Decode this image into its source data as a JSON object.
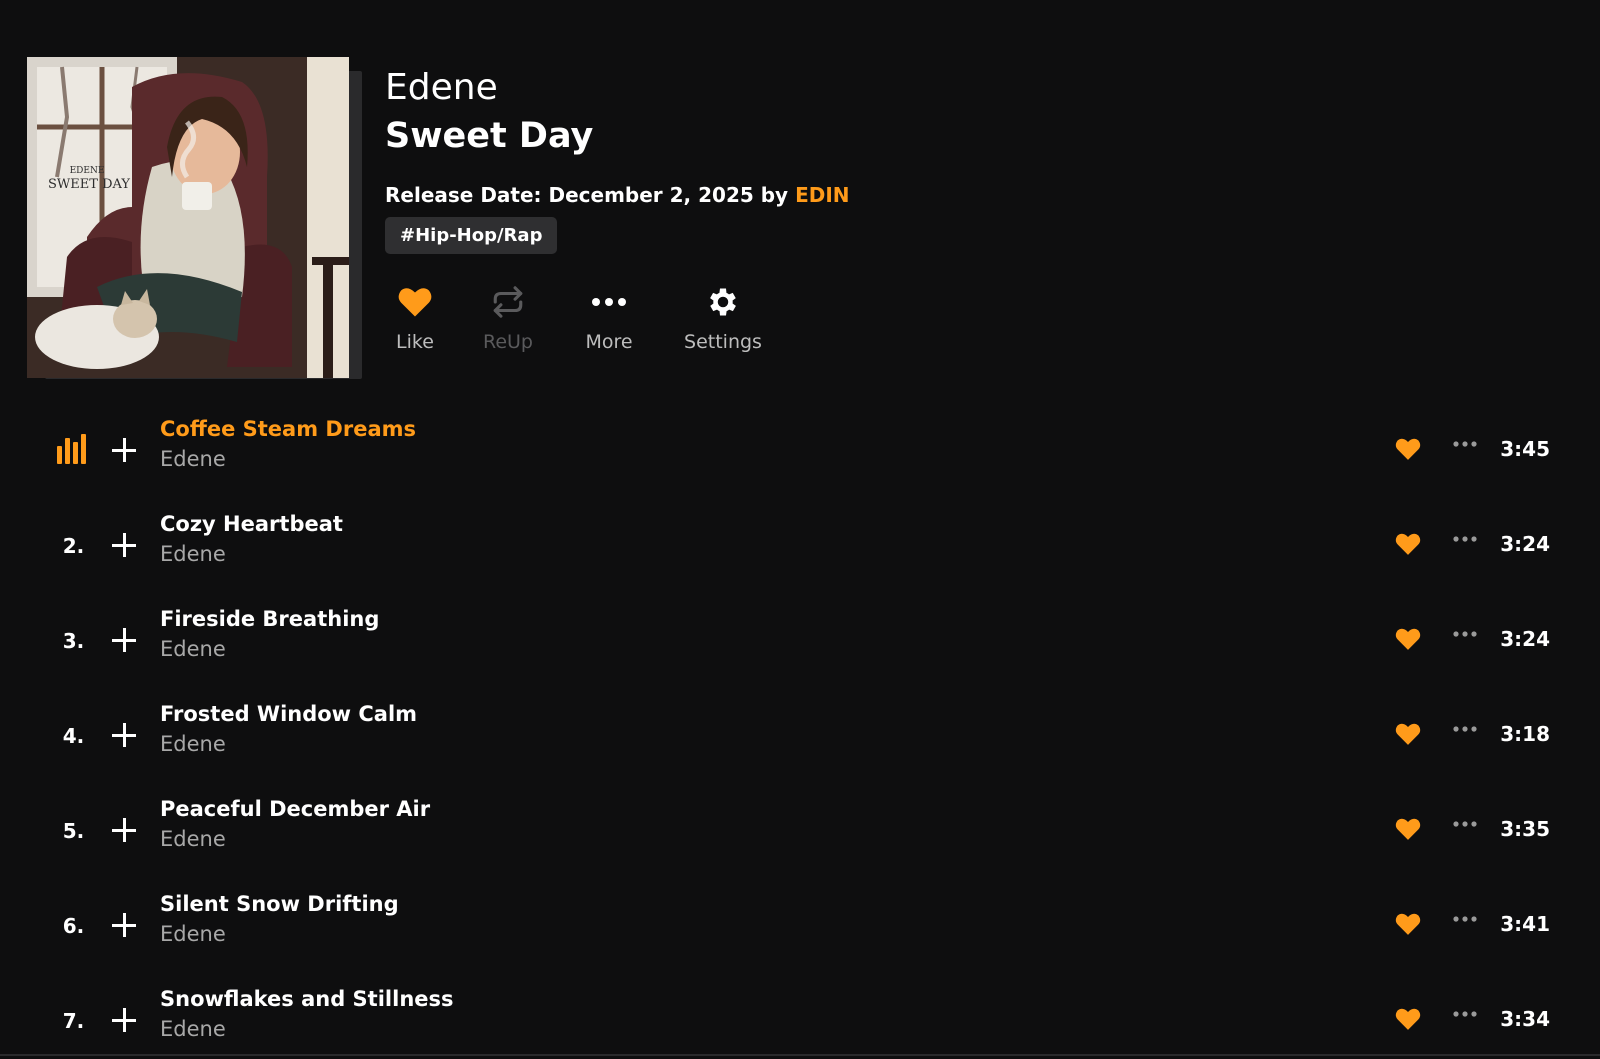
{
  "album": {
    "artist": "Edene",
    "title": "Sweet Day",
    "release_prefix": "Release Date: December 2, 2025 by ",
    "uploader": "EDIN",
    "tag": "#Hip-Hop/Rap",
    "cover_text_line1": "EDENE",
    "cover_text_line2": "SWEET DAY"
  },
  "actions": [
    {
      "label": "Like",
      "icon": "heart-icon",
      "color": "#ff9b1a"
    },
    {
      "label": "ReUp",
      "icon": "repost-icon",
      "disabled": true
    },
    {
      "label": "More",
      "icon": "more-dots-icon"
    },
    {
      "label": "Settings",
      "icon": "gear-icon"
    }
  ],
  "colors": {
    "accent": "#ff9b1a",
    "background": "#0e0e0f",
    "secondary_text": "#a8a8a8"
  },
  "tracks": [
    {
      "number": "",
      "playing": true,
      "name": "Coffee Steam Dreams",
      "artist": "Edene",
      "duration": "3:45"
    },
    {
      "number": "2.",
      "name": "Cozy Heartbeat",
      "artist": "Edene",
      "duration": "3:24"
    },
    {
      "number": "3.",
      "name": "Fireside Breathing",
      "artist": "Edene",
      "duration": "3:24"
    },
    {
      "number": "4.",
      "name": "Frosted Window Calm",
      "artist": "Edene",
      "duration": "3:18"
    },
    {
      "number": "5.",
      "name": "Peaceful December Air",
      "artist": "Edene",
      "duration": "3:35"
    },
    {
      "number": "6.",
      "name": "Silent Snow Drifting",
      "artist": "Edene",
      "duration": "3:41"
    },
    {
      "number": "7.",
      "name": "Snowflakes and Stillness",
      "artist": "Edene",
      "duration": "3:34"
    }
  ]
}
